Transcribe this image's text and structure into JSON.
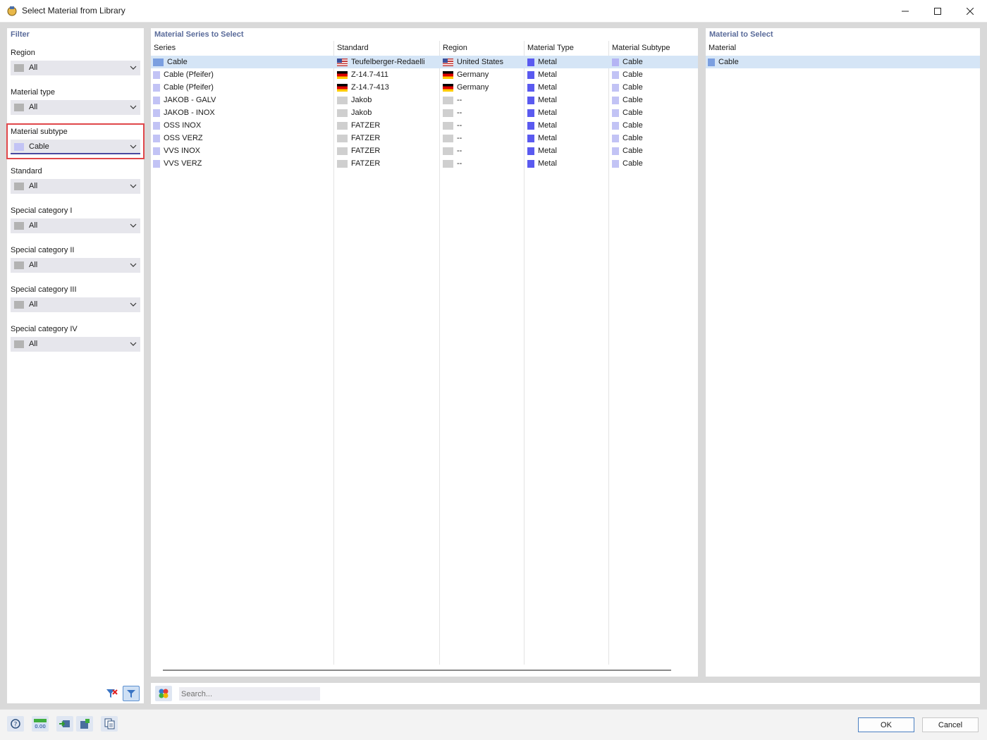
{
  "window": {
    "title": "Select Material from Library"
  },
  "filter": {
    "title": "Filter",
    "fields": [
      {
        "label": "Region",
        "value": "All"
      },
      {
        "label": "Material type",
        "value": "All"
      },
      {
        "label": "Material subtype",
        "value": "Cable"
      },
      {
        "label": "Standard",
        "value": "All"
      },
      {
        "label": "Special category I",
        "value": "All"
      },
      {
        "label": "Special category II",
        "value": "All"
      },
      {
        "label": "Special category III",
        "value": "All"
      },
      {
        "label": "Special category IV",
        "value": "All"
      }
    ]
  },
  "series": {
    "title": "Material Series to Select",
    "columns": [
      "Series",
      "Standard",
      "Region",
      "Material Type",
      "Material Subtype"
    ],
    "rows": [
      {
        "series": "Cable",
        "standard": "Teufelberger-Redaelli",
        "region": "United States",
        "type": "Metal",
        "subtype": "Cable"
      },
      {
        "series": "Cable (Pfeifer)",
        "standard": "Z-14.7-411",
        "region": "Germany",
        "type": "Metal",
        "subtype": "Cable"
      },
      {
        "series": "Cable (Pfeifer)",
        "standard": "Z-14.7-413",
        "region": "Germany",
        "type": "Metal",
        "subtype": "Cable"
      },
      {
        "series": "JAKOB - GALV",
        "standard": "Jakob",
        "region": "--",
        "type": "Metal",
        "subtype": "Cable"
      },
      {
        "series": "JAKOB - INOX",
        "standard": "Jakob",
        "region": "--",
        "type": "Metal",
        "subtype": "Cable"
      },
      {
        "series": "OSS INOX",
        "standard": "FATZER",
        "region": "--",
        "type": "Metal",
        "subtype": "Cable"
      },
      {
        "series": "OSS VERZ",
        "standard": "FATZER",
        "region": "--",
        "type": "Metal",
        "subtype": "Cable"
      },
      {
        "series": "VVS INOX",
        "standard": "FATZER",
        "region": "--",
        "type": "Metal",
        "subtype": "Cable"
      },
      {
        "series": "VVS VERZ",
        "standard": "FATZER",
        "region": "--",
        "type": "Metal",
        "subtype": "Cable"
      }
    ]
  },
  "material": {
    "title": "Material to Select",
    "column": "Material",
    "rows": [
      "Cable"
    ]
  },
  "search": {
    "placeholder": "Search..."
  },
  "buttons": {
    "ok": "OK",
    "cancel": "Cancel"
  },
  "bottom_tool_icons": [
    "help-icon",
    "units-icon",
    "import-icon",
    "library-save-icon",
    "document-copy-icon"
  ],
  "colors": {
    "selection": "#d5e5f6",
    "panel_title": "#5a6b9a",
    "highlight": "#e0474a"
  }
}
